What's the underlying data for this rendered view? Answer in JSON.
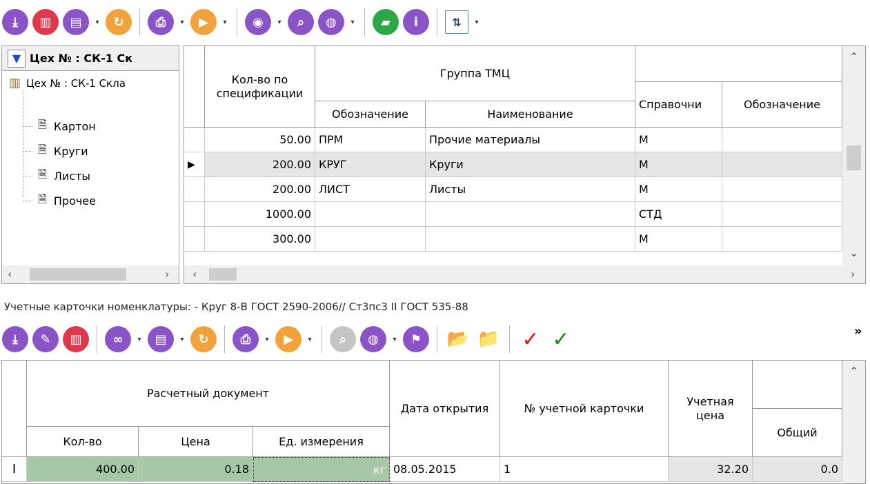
{
  "toolbar_top": {
    "icons": [
      "save-icon",
      "delete-icon",
      "clipboard-icon",
      "refresh-icon",
      "print-icon",
      "run-icon",
      "view-icon",
      "search-icon",
      "globe-icon",
      "open-folder-icon",
      "info-icon",
      "filter-icon"
    ]
  },
  "tree": {
    "header": "Цех № : СК-1  Ск",
    "root": "Цех № : СК-1  Скла",
    "items": [
      "Картон",
      "Круги",
      "Листы",
      "Прочее"
    ]
  },
  "top_grid": {
    "headers": {
      "qty": "Кол-во по спецификации",
      "group": "Группа ТМЦ",
      "designation": "Обозначение",
      "name": "Наименование",
      "reference": "Справочни",
      "designation2": "Обозначение"
    },
    "rows": [
      {
        "qty": "50.00",
        "designation": "ПРМ",
        "name": "Прочие материалы",
        "ref": "М"
      },
      {
        "qty": "200.00",
        "designation": "КРУГ",
        "name": "Круги",
        "ref": "М"
      },
      {
        "qty": "200.00",
        "designation": "ЛИСТ",
        "name": "Листы",
        "ref": "М"
      },
      {
        "qty": "1000.00",
        "designation": "",
        "name": "",
        "ref": "СТД"
      },
      {
        "qty": "300.00",
        "designation": "",
        "name": "",
        "ref": "М"
      }
    ]
  },
  "cards_label": "Учетные карточки номенклатуры: - Круг 8-В ГОСТ 2590-2006// Ст3пс3 II ГОСТ 535-88",
  "bottom_grid": {
    "headers": {
      "doc": "Расчетный документ",
      "qty": "Кол-во",
      "price": "Цена",
      "unit": "Ед. измерения",
      "date": "Дата открытия",
      "card_no": "№ учетной карточки",
      "acc_price": "Учетная цена",
      "total": "Общий"
    },
    "row": {
      "qty": "400.00",
      "price": "0.18",
      "unit": "кг",
      "date": "08.05.2015",
      "card_no": "1",
      "acc_price": "32.20",
      "total": "0.0"
    }
  },
  "colors": {
    "accent": "#8a54c8",
    "delete": "#e0384b",
    "run": "#f2a23b",
    "green": "#2aa845",
    "row_highlight": "#e6e6e6",
    "edit_row": "#a6c8a6"
  }
}
